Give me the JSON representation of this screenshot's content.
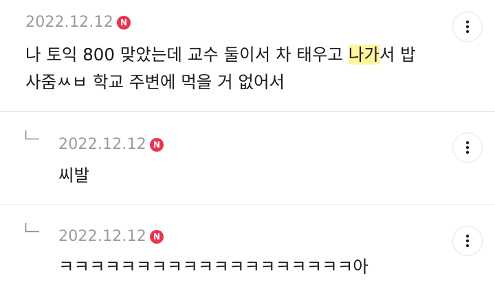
{
  "comments": [
    {
      "date": "2022.12.12",
      "badge": "N",
      "text_line1_before": "나 토익 800 맞았는데 교수 둘이서 차 태우고 ",
      "text_line1_highlight": "나가",
      "text_line1_after": "서 밥",
      "text_line2": "사줌ㅆㅂ 학교 주변에 먹을 거 없어서",
      "more_icon": "vertical-ellipsis-icon"
    },
    {
      "date": "2022.12.12",
      "badge": "N",
      "text": "씨발",
      "reply_icon": "reply-arrow-icon",
      "more_icon": "vertical-ellipsis-icon"
    },
    {
      "date": "2022.12.12",
      "badge": "N",
      "text": "ㅋㅋㅋㅋㅋㅋㅋㅋㅋㅋㅋㅋㅋㅋㅋㅋㅋㅋㅋ아",
      "reply_icon": "reply-arrow-icon",
      "more_icon": "vertical-ellipsis-icon"
    }
  ],
  "colors": {
    "badge": "#e8344e",
    "highlight": "#fff59a",
    "meta_text": "#9b9b9b",
    "body_text": "#1a1a1a",
    "divider": "#e6e6e6"
  }
}
